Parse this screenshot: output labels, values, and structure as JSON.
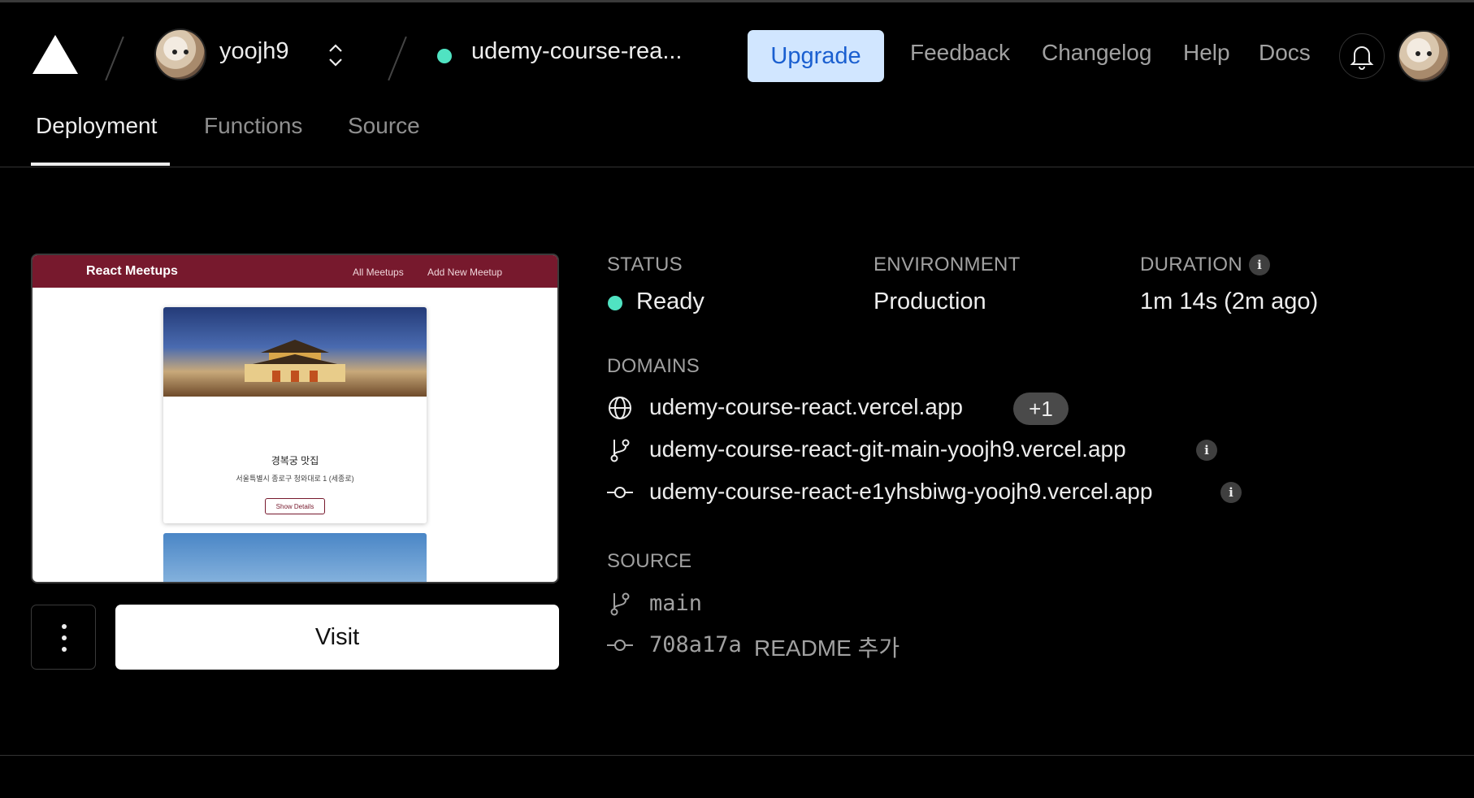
{
  "header": {
    "team": "yoojh9",
    "project": "udemy-course-rea...",
    "upgrade_label": "Upgrade",
    "nav": [
      "Feedback",
      "Changelog",
      "Help",
      "Docs"
    ]
  },
  "tabs": [
    {
      "label": "Deployment",
      "active": true
    },
    {
      "label": "Functions",
      "active": false
    },
    {
      "label": "Source",
      "active": false
    }
  ],
  "preview": {
    "site_title": "React Meetups",
    "links": [
      "All Meetups",
      "Add New Meetup"
    ],
    "card_title": "경복궁 맛집",
    "card_address": "서울특별시 종로구 청와대로 1 (세종로)",
    "card_button": "Show Details"
  },
  "actions": {
    "visit_label": "Visit"
  },
  "details": {
    "status_label": "STATUS",
    "status_value": "Ready",
    "environment_label": "ENVIRONMENT",
    "environment_value": "Production",
    "duration_label": "DURATION",
    "duration_value": "1m 14s (2m ago)",
    "domains_label": "DOMAINS",
    "domains": [
      "udemy-course-react.vercel.app",
      "udemy-course-react-git-main-yoojh9.vercel.app",
      "udemy-course-react-e1yhsbiwg-yoojh9.vercel.app"
    ],
    "extra_domains_badge": "+1",
    "source_label": "SOURCE",
    "branch": "main",
    "commit_hash": "708a17a",
    "commit_message": "README 추가",
    "info_glyph": "i"
  },
  "colors": {
    "status_ready": "#50e3c2",
    "upgrade_bg": "#d1e6ff",
    "upgrade_text": "#1a5fd0",
    "preview_header": "#77192d"
  }
}
